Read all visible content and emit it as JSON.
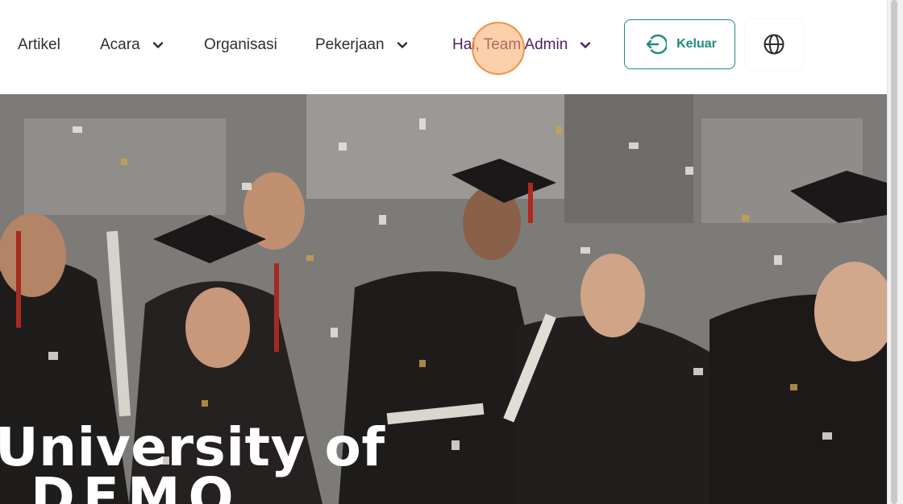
{
  "nav": {
    "items": [
      {
        "label": "Artikel"
      },
      {
        "label": "Acara"
      },
      {
        "label": "Organisasi"
      },
      {
        "label": "Pekerjaan"
      }
    ],
    "user_greeting": "Hai, Team Admin",
    "logout_label": "Keluar",
    "language_icon": "globe-icon"
  },
  "hero": {
    "title_line1": "University of",
    "title_line2": "DEMO"
  },
  "colors": {
    "accent_teal": "#1f8b7f",
    "user_purple": "#4e2163",
    "click_indicator": "#f8aa64"
  }
}
